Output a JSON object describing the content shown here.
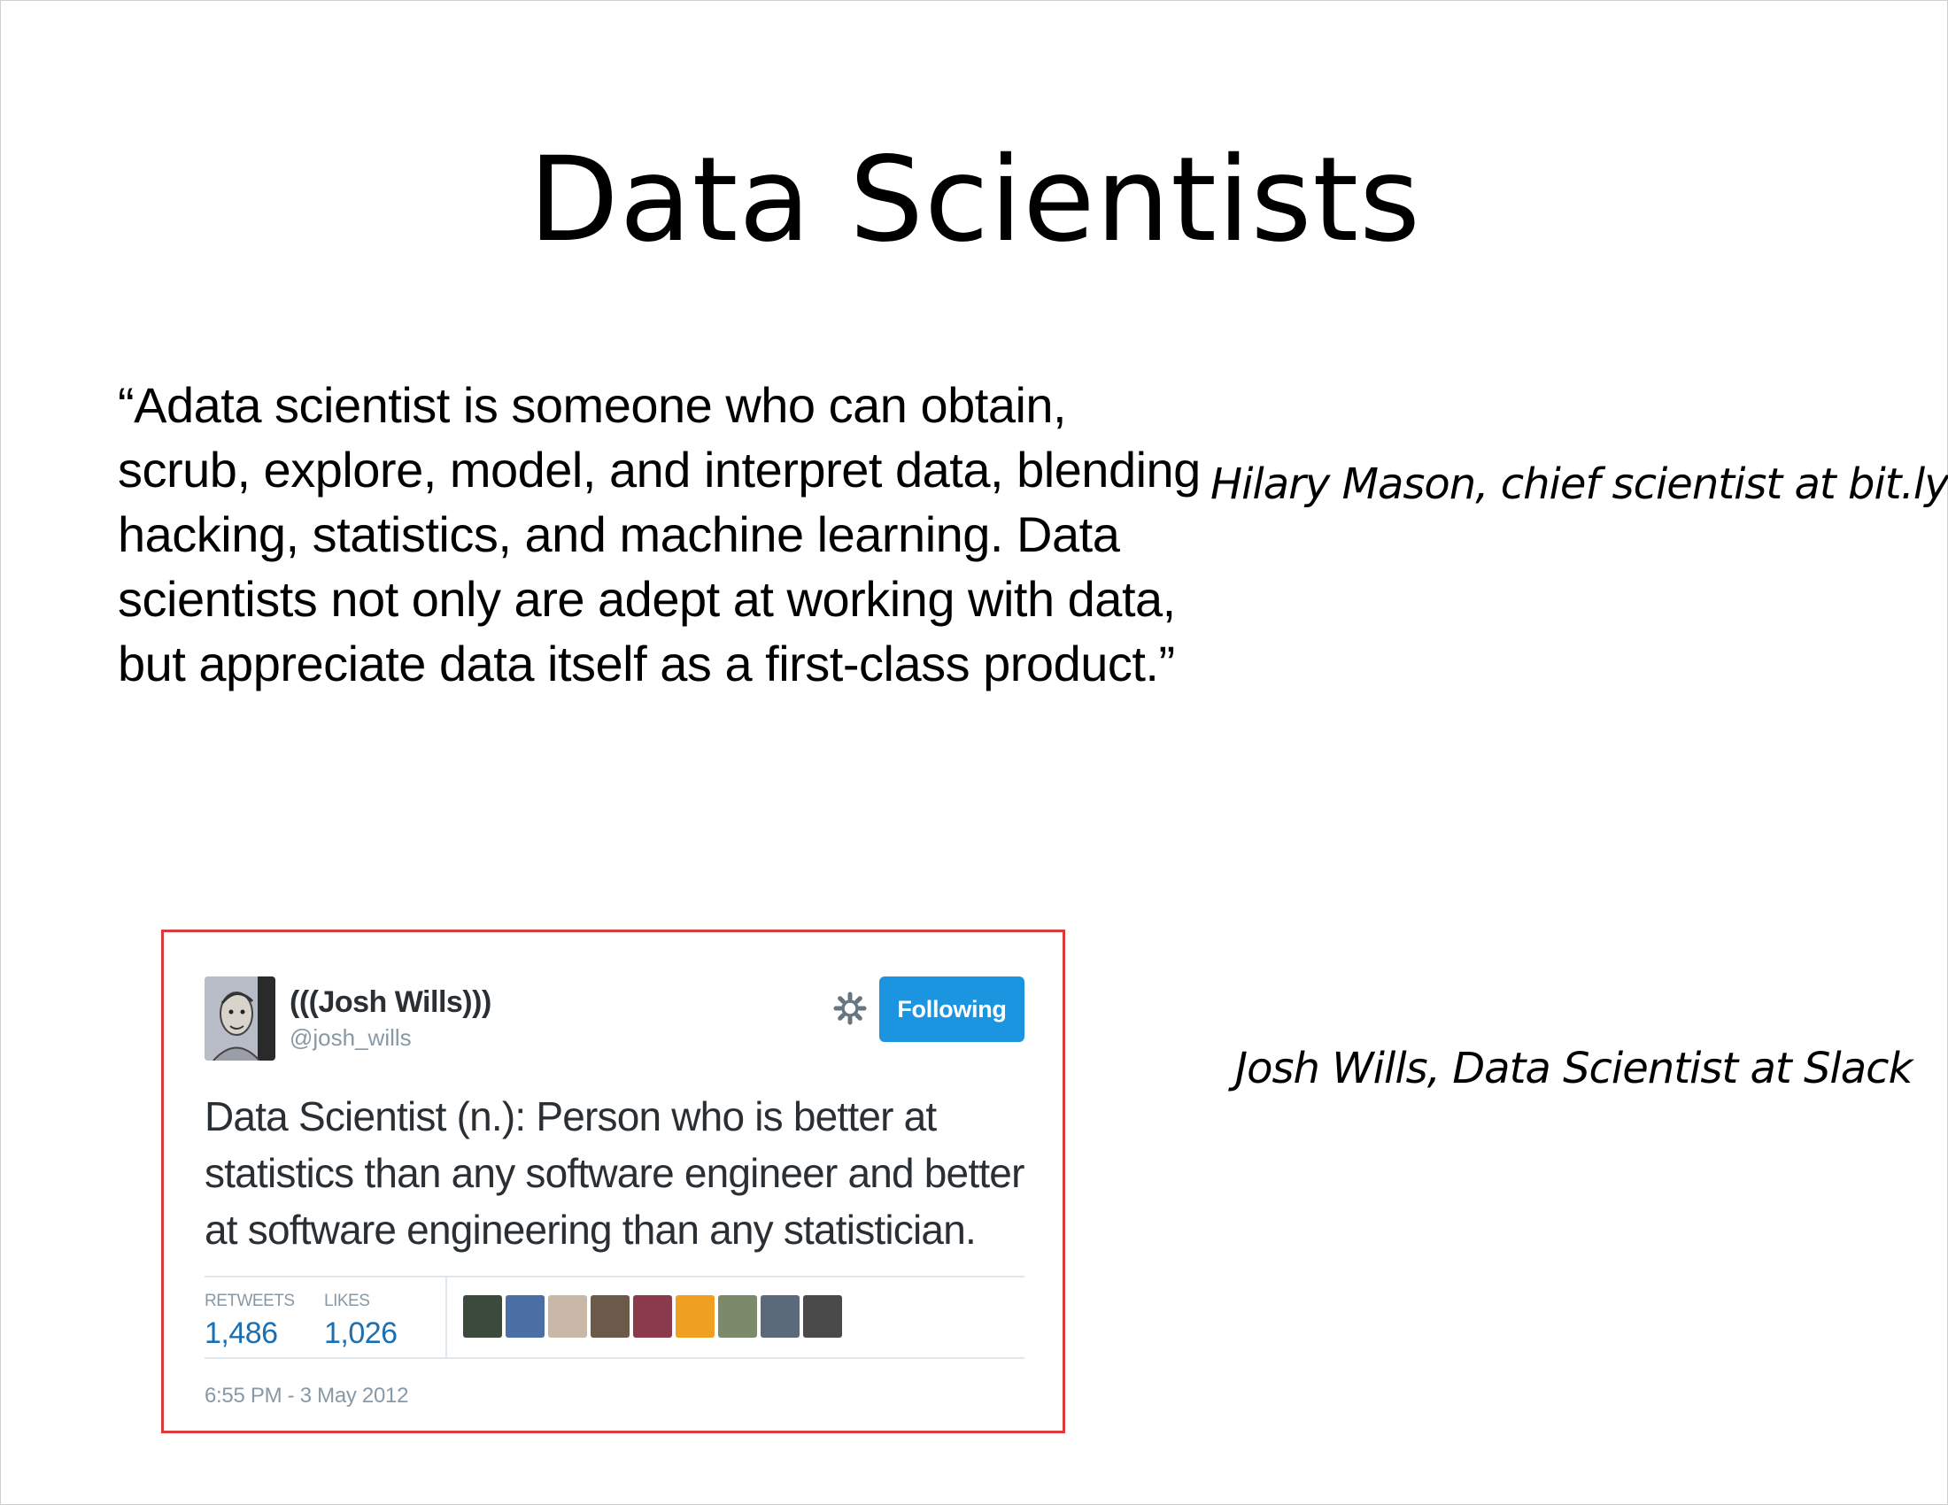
{
  "slide": {
    "title": "Data  Scientists",
    "quote": "“Adata scientist is someone who can obtain, scrub, explore, model, and interpret data, blending hacking, statistics, and machine learning. Data scientists not only are adept at working with data, but appreciate data itself as a first-class product.”",
    "attribution_mason": "Hilary Mason,  chief scientist at bit.ly",
    "attribution_wills": "Josh Wills, Data Scientist at Slack"
  },
  "tweet": {
    "name": "(((Josh Wills)))",
    "handle": "@josh_wills",
    "follow_label": "Following",
    "text": "Data Scientist (n.): Person who is better at statistics than any software engineer and better at software engineering than any statistician.",
    "retweets_label": "RETWEETS",
    "retweets_count": "1,486",
    "likes_label": "LIKES",
    "likes_count": "1,026",
    "timestamp": "6:55 PM - 3 May 2012",
    "liker_colors": [
      "#3b4a3a",
      "#4a6fa5",
      "#c9b7a8",
      "#6b5a4a",
      "#8a3a4a",
      "#f0a020",
      "#7a8a6a",
      "#5a6a7a",
      "#4a4a4a"
    ]
  },
  "colors": {
    "tweet_border": "#d93a3a",
    "follow_button": "#1b95e0",
    "stat_value": "#1b6fb3",
    "muted_text": "#8899a6"
  }
}
